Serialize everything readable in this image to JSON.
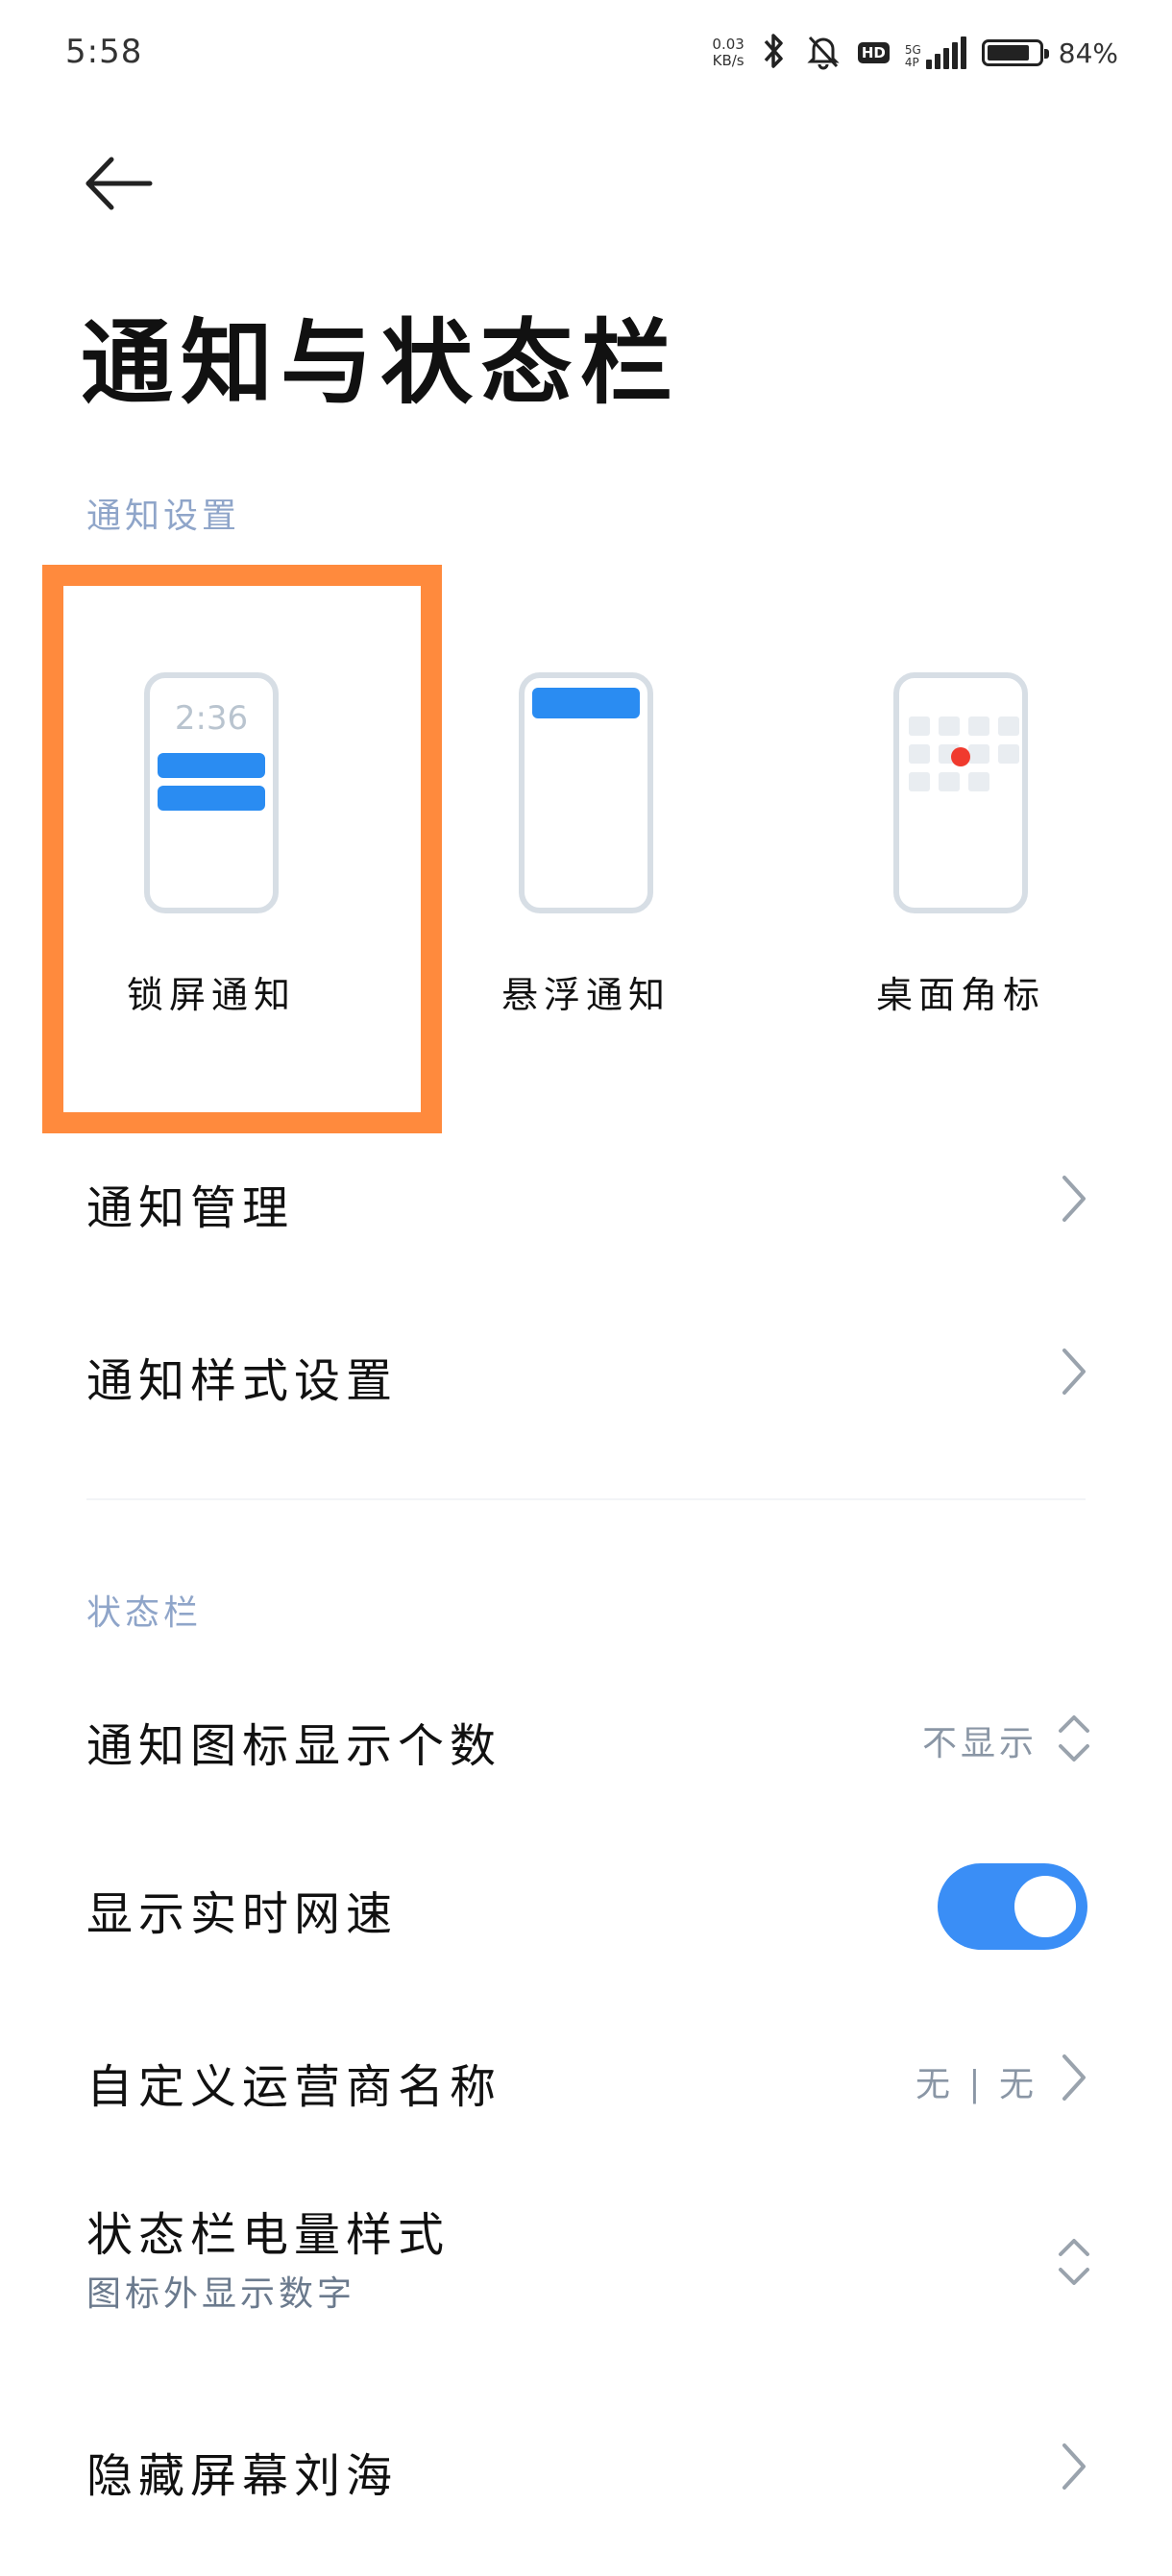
{
  "status_bar": {
    "time": "5:58",
    "net_speed_value": "0.03",
    "net_speed_unit": "KB/s",
    "hd_label": "HD",
    "network_type": "5G",
    "network_sub": "4P",
    "battery_percent": "84%",
    "battery_level": 0.84
  },
  "header": {
    "title": "通知与状态栏"
  },
  "notification_section": {
    "label": "通知设置",
    "cards": [
      {
        "label": "锁屏通知",
        "preview_time": "2:36"
      },
      {
        "label": "悬浮通知"
      },
      {
        "label": "桌面角标"
      }
    ],
    "items": [
      {
        "title": "通知管理"
      },
      {
        "title": "通知样式设置"
      }
    ]
  },
  "status_section": {
    "label": "状态栏",
    "items": [
      {
        "title": "通知图标显示个数",
        "value": "不显示"
      },
      {
        "title": "显示实时网速",
        "toggle_on": true
      },
      {
        "title": "自定义运营商名称",
        "value": "无 | 无"
      },
      {
        "title": "状态栏电量样式",
        "subtitle": "图标外显示数字"
      },
      {
        "title": "隐藏屏幕刘海"
      }
    ]
  },
  "colors": {
    "accent": "#3a8ef6",
    "highlight": "#ff8a3d",
    "section_label": "#8fa5c9",
    "badge_red": "#f03a2e"
  }
}
